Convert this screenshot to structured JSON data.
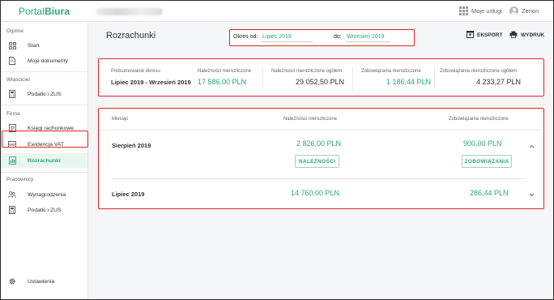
{
  "app": {
    "logo_part1": "Portal",
    "logo_part2": "Biura"
  },
  "topbar": {
    "services_label": "Moje usługi",
    "user_name": "Zenon"
  },
  "sidebar": {
    "sections": [
      {
        "title": "Ogólne",
        "items": [
          {
            "label": "Start",
            "icon": "home-icon"
          },
          {
            "label": "Moje dokumenty",
            "icon": "document-icon"
          }
        ]
      },
      {
        "title": "Właściciel",
        "items": [
          {
            "label": "Podatki i ZUS",
            "icon": "calculator-icon"
          }
        ]
      },
      {
        "title": "Firma",
        "items": [
          {
            "label": "Księgi rachunkowe",
            "icon": "ledger-icon"
          },
          {
            "label": "Ewidencja VAT",
            "icon": "vat-icon"
          },
          {
            "label": "Rozrachunki",
            "icon": "chart-icon",
            "active": true
          }
        ]
      },
      {
        "title": "Pracownicy",
        "items": [
          {
            "label": "Wynagrodzenia",
            "icon": "people-icon"
          },
          {
            "label": "Podatki i ZUS",
            "icon": "calculator-icon"
          }
        ]
      }
    ],
    "settings_label": "Ustawienia"
  },
  "main": {
    "title": "Rozrachunki",
    "period": {
      "from_label": "Okres od:",
      "from_value": "Lipiec 2019",
      "to_label": "do:",
      "to_value": "Wrzesień 2019"
    },
    "actions": {
      "export_label": "EKSPORT",
      "print_label": "WYDRUK"
    },
    "summary": {
      "period_caption": "Podsumowanie okresu",
      "period_value": "Lipiec 2019 - Wrzesień 2019",
      "cols": [
        {
          "title": "Należności nierozliczone",
          "value": "17 586,00 PLN",
          "style": "green"
        },
        {
          "title": "Należności nierozliczone ogółem",
          "value": "29 052,50 PLN",
          "style": "dark"
        },
        {
          "title": "Zobowiązania nierozliczone",
          "value": "1 186,44 PLN",
          "style": "green"
        },
        {
          "title": "Zobowiązania nierozliczone ogółem",
          "value": "4 233,27 PLN",
          "style": "dark"
        }
      ]
    },
    "table": {
      "headers": {
        "month": "Miesiąc",
        "receivables": "Należności nierozliczone",
        "liabilities": "Zobowiązania nierozliczone"
      },
      "rows": [
        {
          "month": "Sierpień 2019",
          "receivables": "2 826,00 PLN",
          "liabilities": "900,00 PLN",
          "expanded": true,
          "receivables_button": "NALEŻNOŚCI",
          "liabilities_button": "ZOBOWIĄZANIA"
        },
        {
          "month": "Lipiec 2019",
          "receivables": "14 760,00 PLN",
          "liabilities": "286,44 PLN",
          "expanded": false
        }
      ]
    }
  },
  "colors": {
    "accent": "#2aa970",
    "highlight": "#e02424"
  }
}
